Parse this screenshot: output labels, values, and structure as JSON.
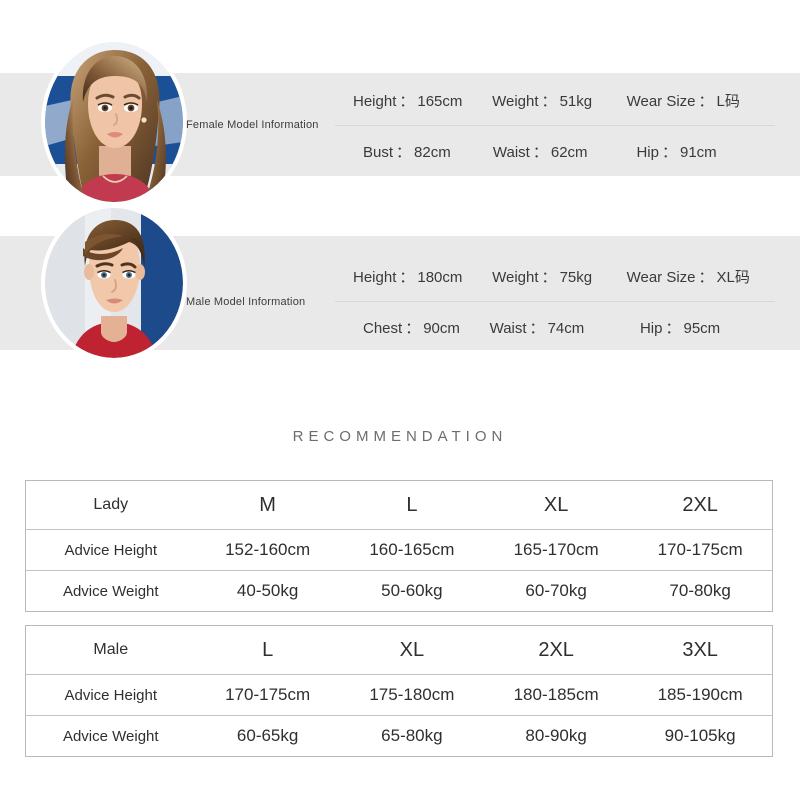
{
  "models": [
    {
      "id": "female",
      "label": "Female Model Information",
      "avatar_icon": "female-model-photo",
      "specs_top": [
        {
          "key": "Height",
          "sep": "：",
          "value": "165cm"
        },
        {
          "key": "Weight",
          "sep": "：",
          "value": "51kg"
        },
        {
          "key": "Wear Size",
          "sep": "：",
          "value": "L码"
        }
      ],
      "specs_bottom": [
        {
          "key": "Bust",
          "sep": "：",
          "value": "82cm"
        },
        {
          "key": "Waist",
          "sep": "：",
          "value": "62cm"
        },
        {
          "key": "Hip",
          "sep": "：",
          "value": "91cm"
        }
      ]
    },
    {
      "id": "male",
      "label": "Male Model Information",
      "avatar_icon": "male-model-photo",
      "specs_top": [
        {
          "key": "Height",
          "sep": "：",
          "value": "180cm"
        },
        {
          "key": "Weight",
          "sep": "：",
          "value": "75kg"
        },
        {
          "key": "Wear Size",
          "sep": "：",
          "value": "XL码"
        }
      ],
      "specs_bottom": [
        {
          "key": "Chest",
          "sep": "：",
          "value": "90cm"
        },
        {
          "key": "Waist",
          "sep": "：",
          "value": "74cm"
        },
        {
          "key": "Hip",
          "sep": "：",
          "value": "95cm"
        }
      ]
    }
  ],
  "recommendation": {
    "title": "RECOMMENDATION",
    "tables": [
      {
        "id": "lady-size-table",
        "header": [
          "Lady",
          "M",
          "L",
          "XL",
          "2XL"
        ],
        "rows": [
          [
            "Advice Height",
            "152-160cm",
            "160-165cm",
            "165-170cm",
            "170-175cm"
          ],
          [
            "Advice Weight",
            "40-50kg",
            "50-60kg",
            "60-70kg",
            "70-80kg"
          ]
        ]
      },
      {
        "id": "male-size-table",
        "header": [
          "Male",
          "L",
          "XL",
          "2XL",
          "3XL"
        ],
        "rows": [
          [
            "Advice Height",
            "170-175cm",
            "175-180cm",
            "180-185cm",
            "185-190cm"
          ],
          [
            "Advice Weight",
            "60-65kg",
            "65-80kg",
            "80-90kg",
            "90-105kg"
          ]
        ]
      }
    ]
  },
  "colors": {
    "band": "#e9e9e9",
    "page_background": "#ffffff",
    "table_border": "#b9b9b9",
    "title_text": "#6d6d6d",
    "body_text": "#333333"
  }
}
